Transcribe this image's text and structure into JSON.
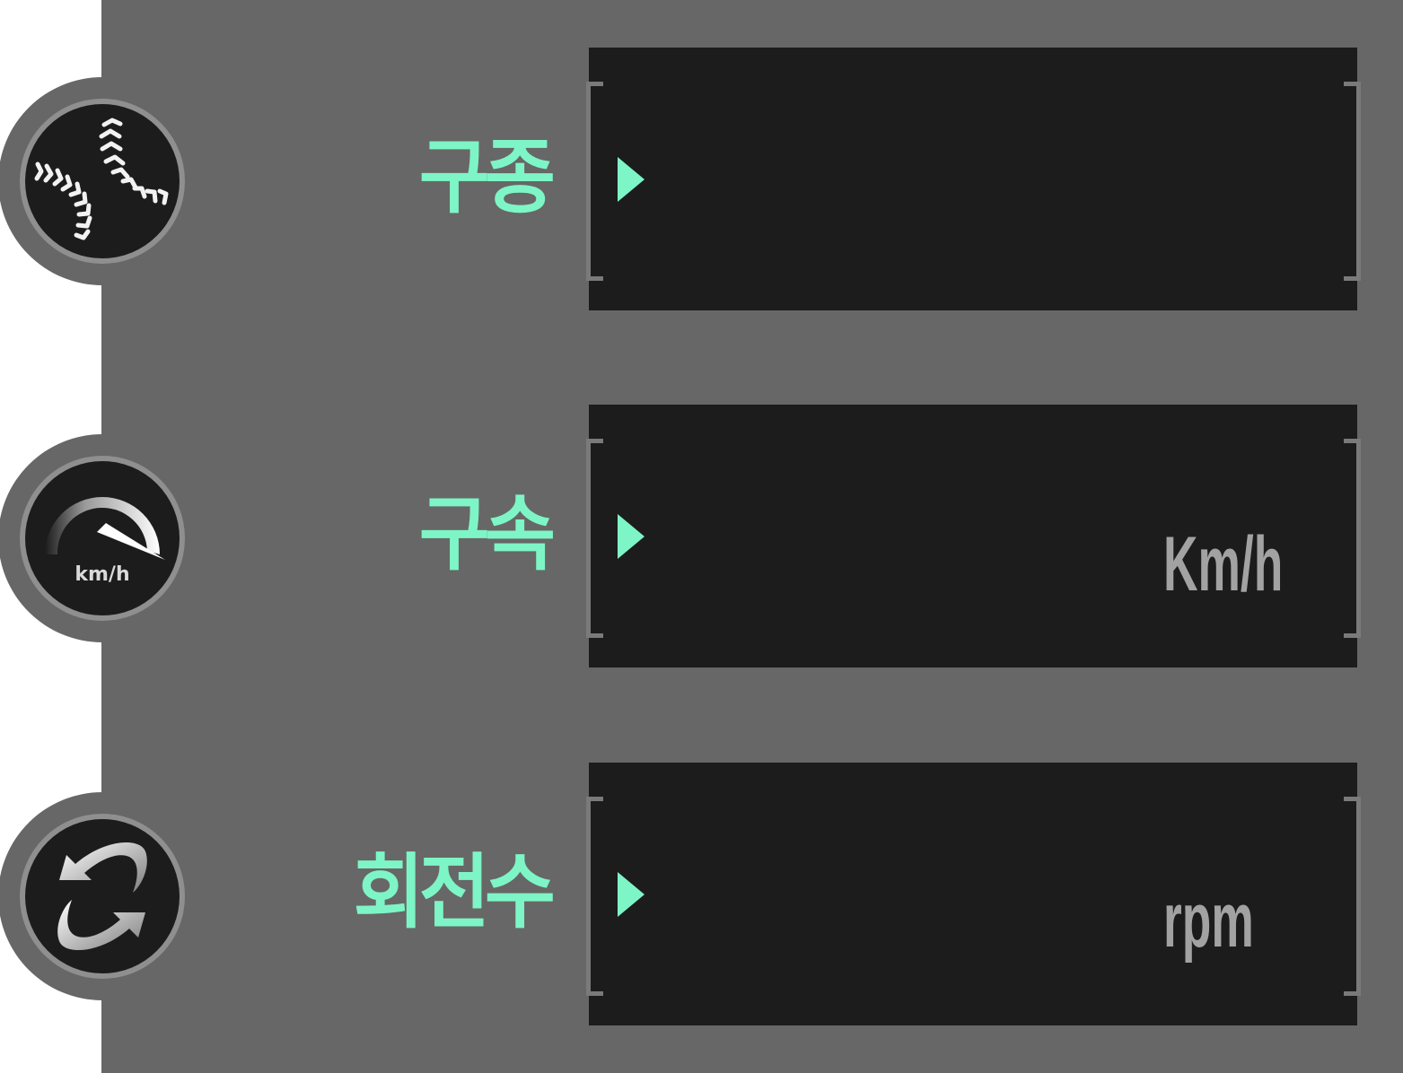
{
  "rows": [
    {
      "icon": "baseball-icon",
      "label": "구종",
      "value": "",
      "unit": ""
    },
    {
      "icon": "speedometer-icon",
      "icon_text": "km/h",
      "label": "구속",
      "value": "",
      "unit": "Km/h"
    },
    {
      "icon": "rotation-icon",
      "label": "회전수",
      "value": "",
      "unit": "rpm"
    }
  ],
  "colors": {
    "panel": "#676767",
    "display": "#1c1c1c",
    "accent": "#7ef5c6",
    "unit_text": "#a2a2a2",
    "bracket": "#7a7a7a"
  }
}
